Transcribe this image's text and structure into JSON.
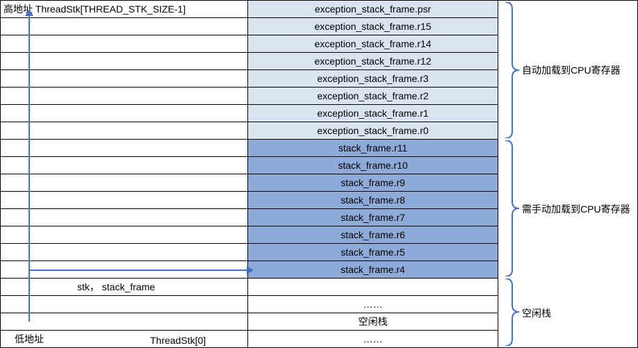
{
  "labels": {
    "high_addr": "高地址 ThreadStk[THREAD_STK_SIZE-1]",
    "stk_ptr": "stk，  stack_frame",
    "low_addr": "低地址",
    "thread0": "ThreadStk[0]"
  },
  "mid_rows": [
    "exception_stack_frame.psr",
    "exception_stack_frame.r15",
    "exception_stack_frame.r14",
    "exception_stack_frame.r12",
    "exception_stack_frame.r3",
    "exception_stack_frame.r2",
    "exception_stack_frame.r1",
    "exception_stack_frame.r0",
    "stack_frame.r11",
    "stack_frame.r10",
    "stack_frame.r9",
    "stack_frame.r8",
    "stack_frame.r7",
    "stack_frame.r6",
    "stack_frame.r5",
    "stack_frame.r4",
    "",
    "……",
    "空闲栈",
    "……"
  ],
  "annotations": {
    "auto_load": "自动加载到CPU寄存器",
    "manual_load": "需手动加载到CPU寄存器",
    "idle_stack": "空闲栈"
  }
}
